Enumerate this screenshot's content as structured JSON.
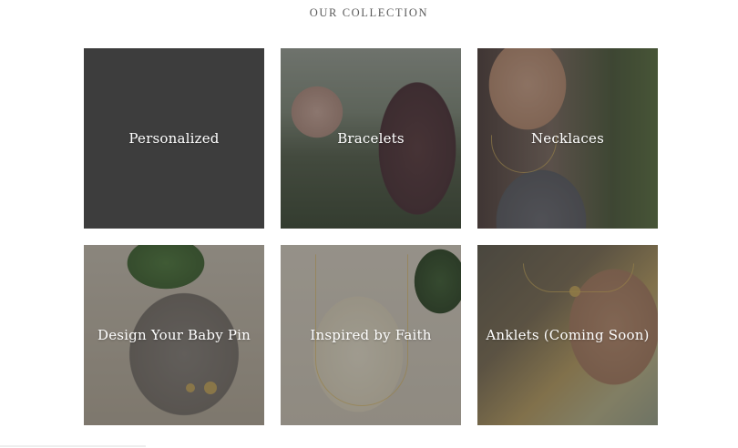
{
  "section": {
    "heading": "OUR COLLECTION"
  },
  "tiles": [
    {
      "label": "Personalized"
    },
    {
      "label": "Bracelets"
    },
    {
      "label": "Necklaces"
    },
    {
      "label": "Design Your Baby Pin"
    },
    {
      "label": "Inspired by Faith"
    },
    {
      "label": "Anklets (Coming Soon)"
    }
  ],
  "colors": {
    "overlay": "#3d3d3d",
    "label_text": "#ffffff",
    "heading_text": "#5a5a5a",
    "page_background": "#ffffff"
  }
}
